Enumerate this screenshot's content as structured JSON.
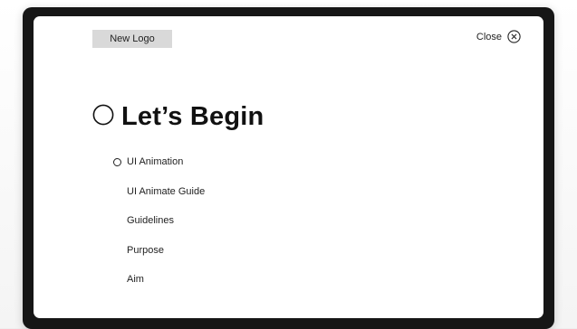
{
  "header": {
    "logo_label": "New Logo",
    "close_label": "Close"
  },
  "main": {
    "title": "Let’s Begin",
    "menu": [
      {
        "label": "UI Animation",
        "active": true
      },
      {
        "label": "UI Animate Guide",
        "active": false
      },
      {
        "label": "Guidelines",
        "active": false
      },
      {
        "label": "Purpose",
        "active": false
      },
      {
        "label": "Aim",
        "active": false
      }
    ]
  },
  "icons": {
    "close": "close-circle-icon",
    "title_marker": "circle-outline-icon",
    "active_item_marker": "small-circle-icon"
  },
  "colors": {
    "device_frame": "#161616",
    "screen": "#ffffff",
    "logo_badge": "#d9d9d9",
    "text": "#1f1f1f"
  }
}
